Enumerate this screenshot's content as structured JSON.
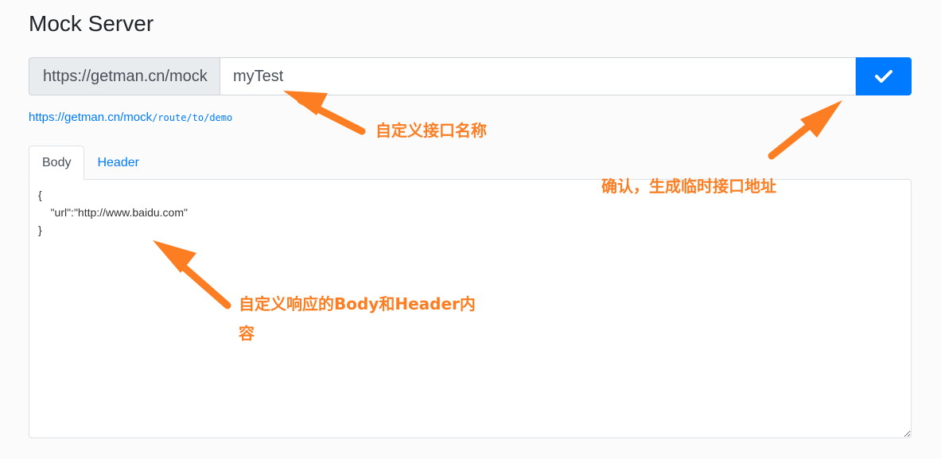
{
  "page": {
    "title": "Mock Server"
  },
  "url_bar": {
    "prefix": "https://getman.cn/mock",
    "name_value": "myTest"
  },
  "url_hint": {
    "base": "https://getman.cn/mock",
    "route": "/route/to/demo"
  },
  "tabs": [
    {
      "label": "Body",
      "active": true
    },
    {
      "label": "Header",
      "active": false
    }
  ],
  "editor": {
    "content": "{\n    \"url\":\"http://www.baidu.com\"\n}"
  },
  "annotations": {
    "name_label": "自定义接口名称",
    "confirm_label": "确认，生成临时接口地址",
    "body_label_line1": "自定义响应的Body和Header内",
    "body_label_line2": "容"
  },
  "colors": {
    "accent": "#007bff",
    "annotation": "#fd7e22",
    "prefix_bg": "#e9ecef"
  },
  "icons": {
    "confirm": "check-icon"
  }
}
